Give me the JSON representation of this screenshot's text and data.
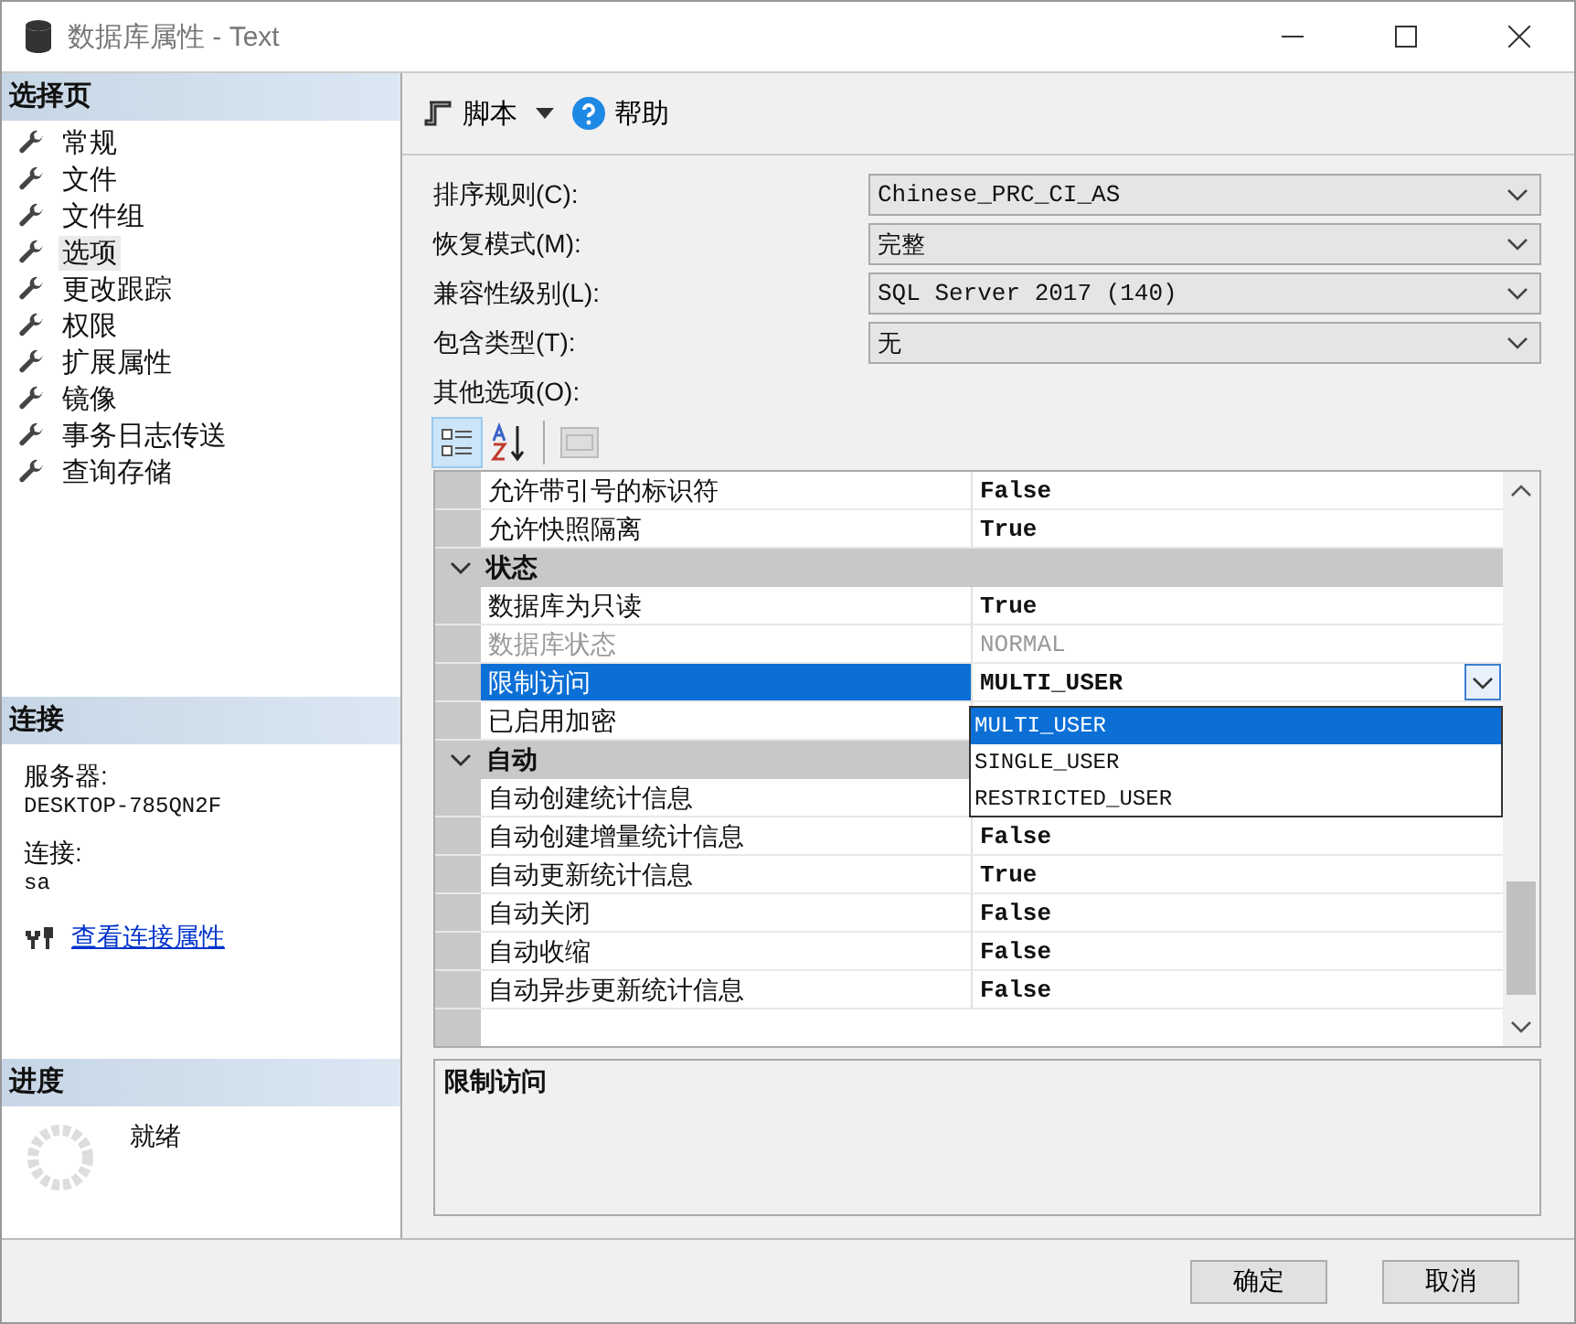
{
  "window": {
    "title": "数据库属性 - Text"
  },
  "sidebar": {
    "header": "选择页",
    "items": [
      {
        "label": "常规",
        "selected": false
      },
      {
        "label": "文件",
        "selected": false
      },
      {
        "label": "文件组",
        "selected": false
      },
      {
        "label": "选项",
        "selected": true
      },
      {
        "label": "更改跟踪",
        "selected": false
      },
      {
        "label": "权限",
        "selected": false
      },
      {
        "label": "扩展属性",
        "selected": false
      },
      {
        "label": "镜像",
        "selected": false
      },
      {
        "label": "事务日志传送",
        "selected": false
      },
      {
        "label": "查询存储",
        "selected": false
      }
    ]
  },
  "connection": {
    "header": "连接",
    "server_label": "服务器:",
    "server": "DESKTOP-785QN2F",
    "connection_label": "连接:",
    "connection": "sa",
    "link": "查看连接属性"
  },
  "progress": {
    "header": "进度",
    "status": "就绪"
  },
  "toolbar": {
    "script": "脚本",
    "help": "帮助"
  },
  "fields": [
    {
      "label": "排序规则(C):",
      "value": "Chinese_PRC_CI_AS"
    },
    {
      "label": "恢复模式(M):",
      "value": "完整"
    },
    {
      "label": "兼容性级别(L):",
      "value": "SQL Server 2017 (140)"
    },
    {
      "label": "包含类型(T):",
      "value": "无"
    }
  ],
  "other_options_label": "其他选项(O):",
  "grid_toolbar": {
    "categorized_selected": true,
    "alphabetical_selected": false
  },
  "grid": {
    "rows": [
      {
        "kind": "property",
        "name": "允许带引号的标识符",
        "value": "False",
        "disabled": false,
        "selected": false
      },
      {
        "kind": "property",
        "name": "允许快照隔离",
        "value": "True",
        "disabled": false,
        "selected": false
      },
      {
        "kind": "category",
        "name": "状态",
        "expanded": true
      },
      {
        "kind": "property",
        "name": "数据库为只读",
        "value": "True",
        "disabled": false,
        "selected": false
      },
      {
        "kind": "property",
        "name": "数据库状态",
        "value": "NORMAL",
        "disabled": true,
        "selected": false
      },
      {
        "kind": "property",
        "name": "限制访问",
        "value": "MULTI_USER",
        "disabled": false,
        "selected": true
      },
      {
        "kind": "property",
        "name": "已启用加密",
        "disabled": false,
        "selected": false
      },
      {
        "kind": "category",
        "name": "自动",
        "expanded": true
      },
      {
        "kind": "property",
        "name": "自动创建统计信息",
        "disabled": false,
        "selected": false
      },
      {
        "kind": "property",
        "name": "自动创建增量统计信息",
        "value": "False",
        "disabled": false,
        "selected": false
      },
      {
        "kind": "property",
        "name": "自动更新统计信息",
        "value": "True",
        "disabled": false,
        "selected": false
      },
      {
        "kind": "property",
        "name": "自动关闭",
        "value": "False",
        "disabled": false,
        "selected": false
      },
      {
        "kind": "property",
        "name": "自动收缩",
        "value": "False",
        "disabled": false,
        "selected": false
      },
      {
        "kind": "property",
        "name": "自动异步更新统计信息",
        "value": "False",
        "disabled": false,
        "selected": false
      }
    ],
    "dropdown": [
      {
        "label": "MULTI_USER",
        "selected": true
      },
      {
        "label": "SINGLE_USER",
        "selected": false
      },
      {
        "label": "RESTRICTED_USER",
        "selected": false
      }
    ]
  },
  "description": {
    "title": "限制访问"
  },
  "buttons": [
    "确定",
    "取消"
  ]
}
